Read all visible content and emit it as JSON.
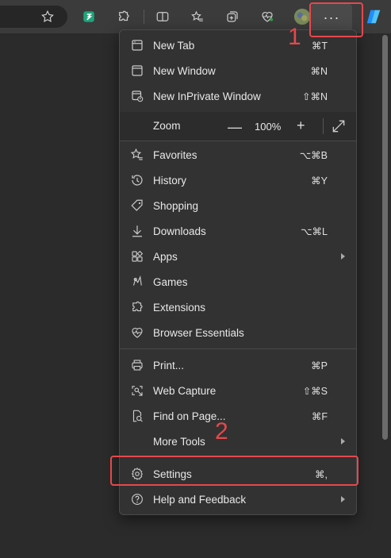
{
  "toolbar": {
    "more_label": "···",
    "icons": [
      "favorites-star-icon",
      "extension-s-icon",
      "puzzle-icon",
      "split-screen-icon",
      "favorites-bar-icon",
      "collections-icon",
      "heart-pulse-icon",
      "profile-avatar",
      "copilot-icon"
    ]
  },
  "menu": {
    "items": [
      {
        "label": "New Tab",
        "shortcut": "⌘T",
        "icon": "new-tab-icon"
      },
      {
        "label": "New Window",
        "shortcut": "⌘N",
        "icon": "new-window-icon"
      },
      {
        "label": "New InPrivate Window",
        "shortcut": "⇧⌘N",
        "icon": "inprivate-icon"
      }
    ],
    "zoom": {
      "label": "Zoom",
      "minus": "—",
      "value": "100%",
      "plus": "+",
      "fullscreen_icon": "fullscreen-icon"
    },
    "group2": [
      {
        "label": "Favorites",
        "shortcut": "⌥⌘B",
        "icon": "favorites-icon"
      },
      {
        "label": "History",
        "shortcut": "⌘Y",
        "icon": "history-icon"
      },
      {
        "label": "Shopping",
        "shortcut": "",
        "icon": "shopping-tag-icon"
      },
      {
        "label": "Downloads",
        "shortcut": "⌥⌘L",
        "icon": "download-icon"
      },
      {
        "label": "Apps",
        "shortcut": "",
        "icon": "apps-icon",
        "submenu": true
      },
      {
        "label": "Games",
        "shortcut": "",
        "icon": "games-icon"
      },
      {
        "label": "Extensions",
        "shortcut": "",
        "icon": "extensions-icon"
      },
      {
        "label": "Browser Essentials",
        "shortcut": "",
        "icon": "heart-pulse-icon"
      }
    ],
    "group3": [
      {
        "label": "Print...",
        "shortcut": "⌘P",
        "icon": "printer-icon"
      },
      {
        "label": "Web Capture",
        "shortcut": "⇧⌘S",
        "icon": "web-capture-icon"
      },
      {
        "label": "Find on Page...",
        "shortcut": "⌘F",
        "icon": "find-icon"
      },
      {
        "label": "More Tools",
        "shortcut": "",
        "icon": "",
        "submenu": true
      }
    ],
    "group4": [
      {
        "label": "Settings",
        "shortcut": "⌘,",
        "icon": "gear-icon"
      },
      {
        "label": "Help and Feedback",
        "shortcut": "",
        "icon": "help-icon",
        "submenu": true
      }
    ]
  },
  "annotations": {
    "step1": "1",
    "step2": "2",
    "color": "#e5484d"
  }
}
